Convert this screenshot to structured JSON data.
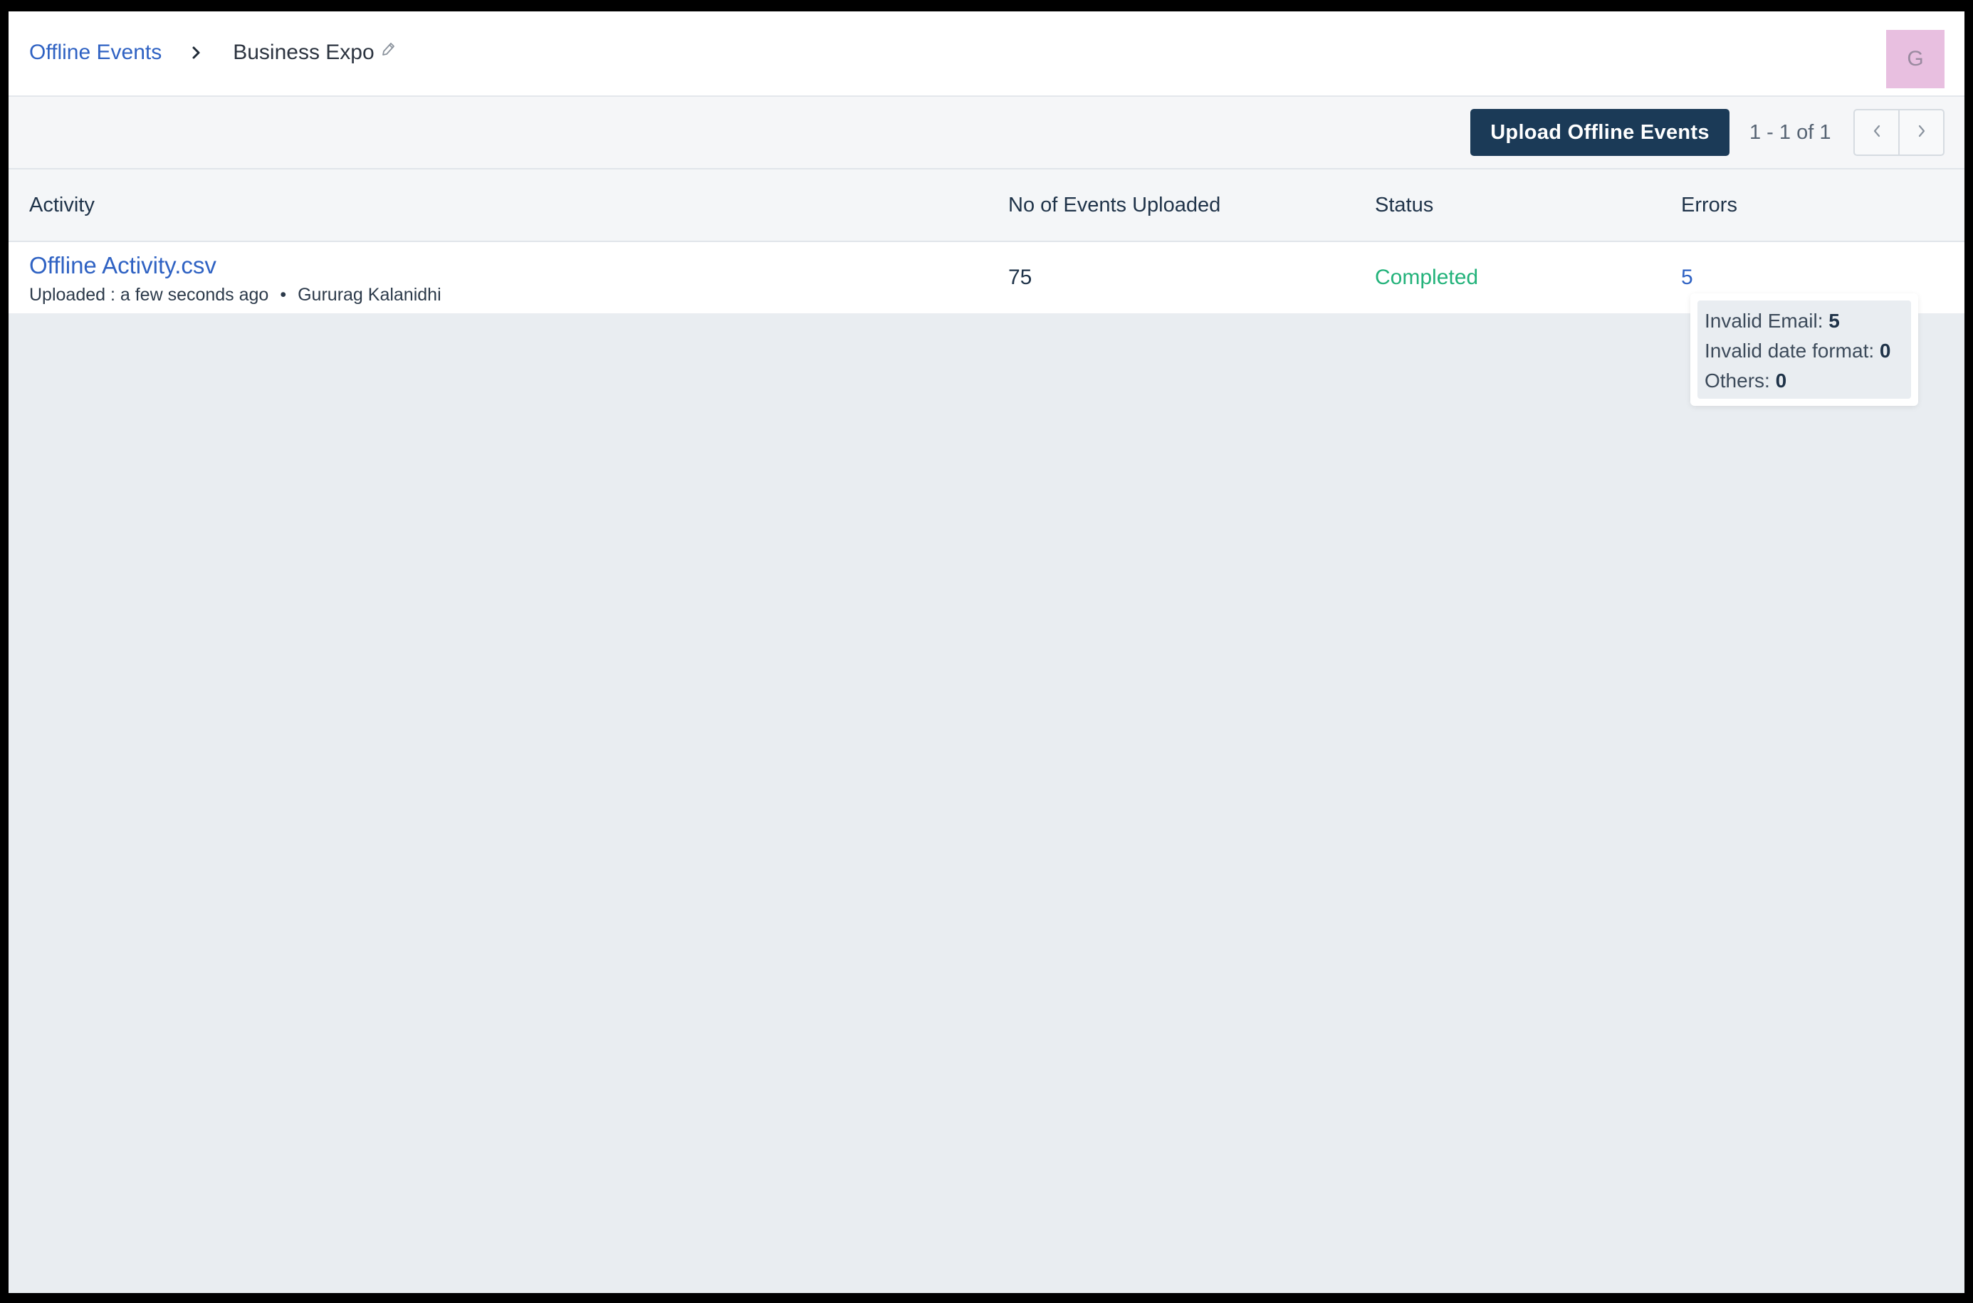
{
  "breadcrumb": {
    "root_label": "Offline Events",
    "current_label": "Business Expo"
  },
  "user": {
    "avatar_initial": "G",
    "avatar_color": "#e8bfe0"
  },
  "toolbar": {
    "upload_label": "Upload Offline Events",
    "pagination_text": "1 - 1 of 1",
    "prev_icon": "chevron-left-icon",
    "next_icon": "chevron-right-icon"
  },
  "table": {
    "columns": [
      "Activity",
      "No of Events Uploaded",
      "Status",
      "Errors"
    ],
    "rows": [
      {
        "file_name": "Offline Activity.csv",
        "uploaded_text": "Uploaded : a few seconds ago",
        "uploaded_by": "Gururag Kalanidhi",
        "events_uploaded": "75",
        "status": "Completed",
        "errors": "5"
      }
    ]
  },
  "errors_tooltip": {
    "items": [
      {
        "label": "Invalid Email:",
        "value": "5"
      },
      {
        "label": "Invalid date format:",
        "value": "0"
      },
      {
        "label": "Others:",
        "value": "0"
      }
    ]
  },
  "colors": {
    "primary_button": "#1b3a57",
    "link": "#2f62c3",
    "status_completed": "#22b27a",
    "page_background": "#e9edf1"
  }
}
